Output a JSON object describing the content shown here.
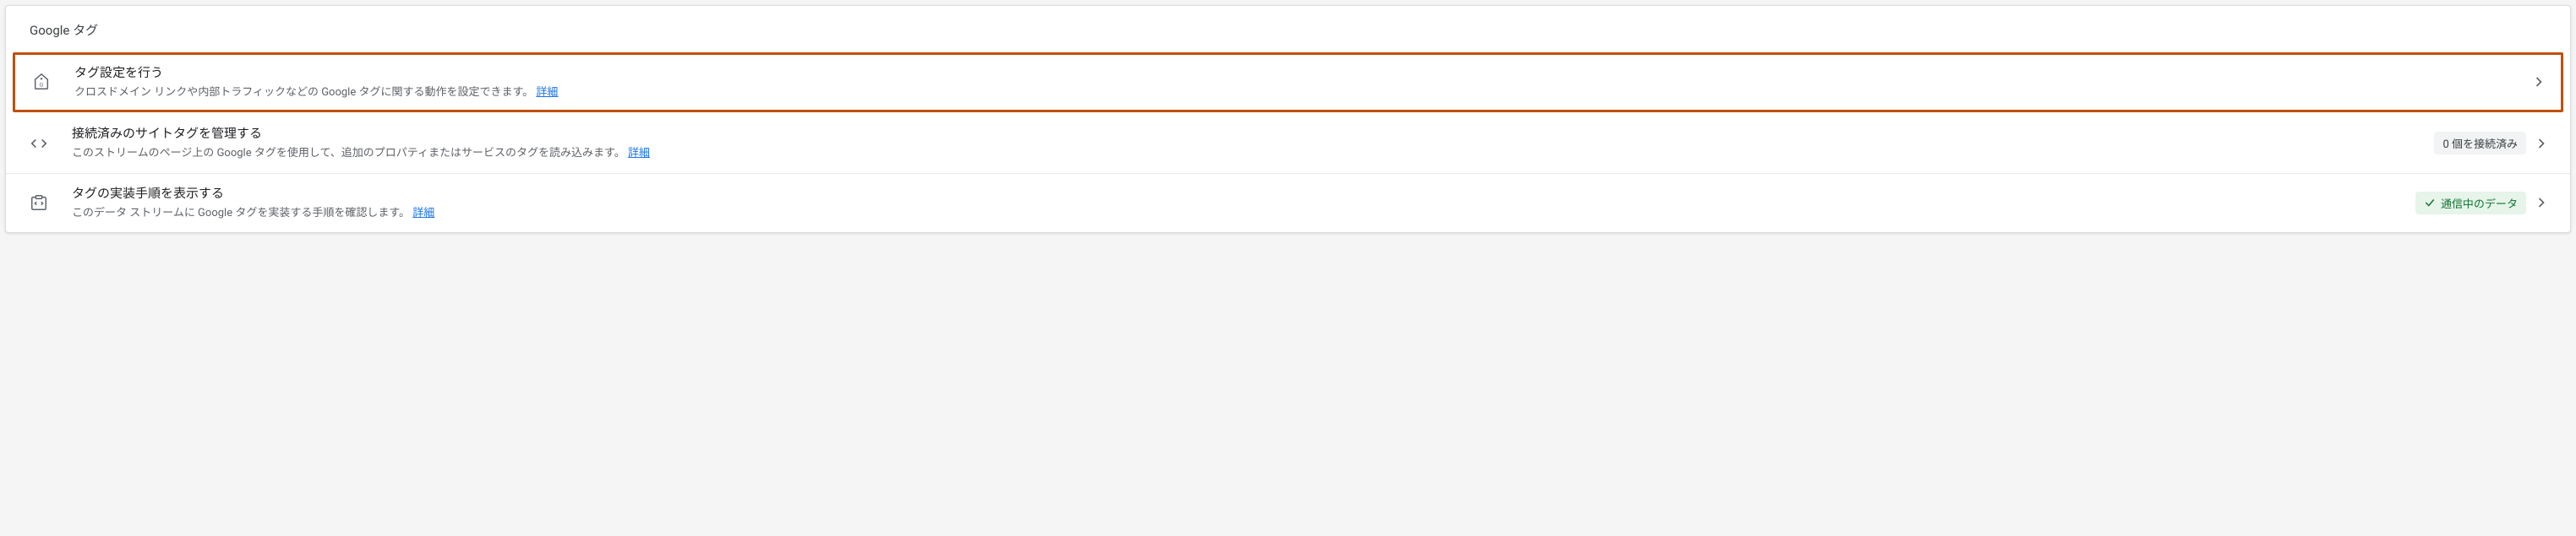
{
  "header": {
    "title": "Google タグ"
  },
  "rows": [
    {
      "title": "タグ設定を行う",
      "desc": "クロスドメイン リンクや内部トラフィックなどの Google タグに関する動作を設定できます。",
      "detail": "詳細"
    },
    {
      "title": "接続済みのサイトタグを管理する",
      "desc": "このストリームのページ上の Google タグを使用して、追加のプロパティまたはサービスのタグを読み込みます。",
      "detail": "詳細",
      "badge": "0 個を接続済み"
    },
    {
      "title": "タグの実装手順を表示する",
      "desc": "このデータ ストリームに Google タグを実装する手順を確認します。",
      "detail": "詳細",
      "status": "通信中のデータ"
    }
  ]
}
